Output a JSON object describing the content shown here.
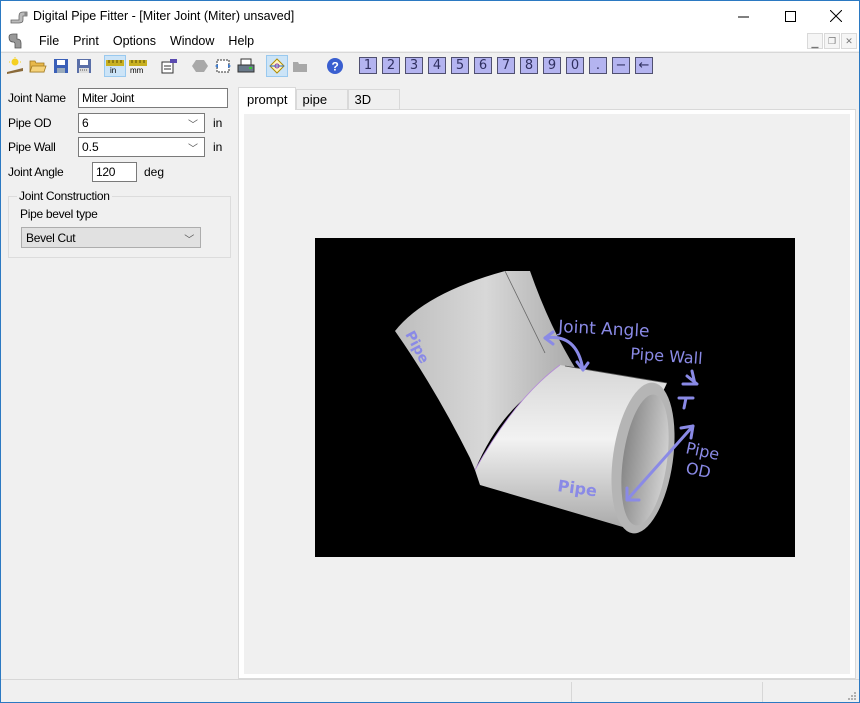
{
  "window": {
    "title": "Digital Pipe Fitter - [Miter Joint (Miter) unsaved]",
    "controls": {
      "minimize": "—",
      "maximize": "☐",
      "close": "✕"
    },
    "mdi_controls": {
      "minimize": "_",
      "restore": "🗗",
      "close": "✕"
    }
  },
  "menu": {
    "items": [
      {
        "label": "File"
      },
      {
        "label": "Print"
      },
      {
        "label": "Options"
      },
      {
        "label": "Window"
      },
      {
        "label": "Help"
      }
    ]
  },
  "toolbar": {
    "buttons": [
      {
        "name": "new-icon"
      },
      {
        "name": "open-icon"
      },
      {
        "name": "save-icon"
      },
      {
        "name": "save-as-icon"
      },
      {
        "name": "inches-icon",
        "label": "in",
        "pressed": true
      },
      {
        "name": "millimeters-icon",
        "label": "mm",
        "pressed": false
      },
      {
        "name": "properties-icon"
      },
      {
        "name": "disabled-shape-icon"
      },
      {
        "name": "select-region-icon"
      },
      {
        "name": "print-icon"
      },
      {
        "name": "joint-view-icon",
        "pressed": true
      },
      {
        "name": "folder-disabled-icon"
      },
      {
        "name": "help-icon",
        "label": "?"
      }
    ],
    "keypad": [
      "1",
      "2",
      "3",
      "4",
      "5",
      "6",
      "7",
      "8",
      "9",
      "0",
      ".",
      "−",
      "←"
    ]
  },
  "form": {
    "joint_name": {
      "label": "Joint Name",
      "value": "Miter Joint"
    },
    "pipe_od": {
      "label": "Pipe OD",
      "value": "6",
      "unit": "in"
    },
    "pipe_wall": {
      "label": "Pipe Wall",
      "value": "0.5",
      "unit": "in"
    },
    "joint_angle": {
      "label": "Joint Angle",
      "value": "120",
      "unit": "deg"
    },
    "joint_construction": {
      "legend": "Joint Construction",
      "bevel_label": "Pipe bevel type",
      "bevel_value": "Bevel Cut"
    }
  },
  "tabs": [
    {
      "label": "prompt",
      "active": true
    },
    {
      "label": "pipe",
      "active": false
    },
    {
      "label": "3D",
      "active": false
    }
  ],
  "diagram": {
    "labels": {
      "joint_angle": "Joint Angle",
      "pipe_wall": "Pipe Wall",
      "pipe_od_1": "Pipe",
      "pipe_od_2": "OD",
      "pipe_left": "Pipe",
      "pipe_bottom": "Pipe"
    },
    "annotation_color": "#8a8ae6",
    "background": "#000000"
  }
}
